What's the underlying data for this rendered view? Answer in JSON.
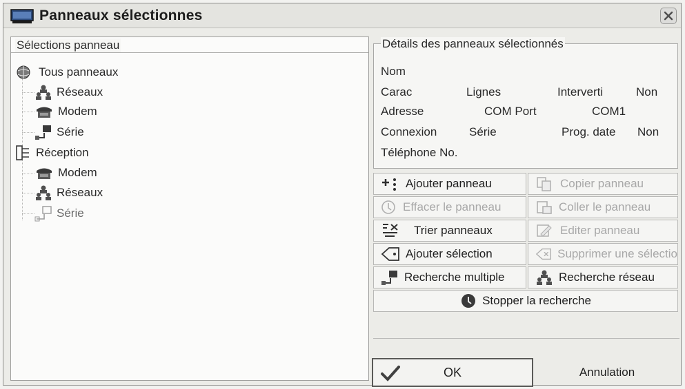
{
  "window": {
    "title": "Panneaux sélectionnes",
    "close_icon": "close-icon"
  },
  "tree": {
    "group_label": "Sélections panneau",
    "root": {
      "label": "Tous panneaux",
      "icon": "globe-icon"
    },
    "root_children": [
      {
        "label": "Réseaux",
        "icon": "network-icon"
      },
      {
        "label": "Modem",
        "icon": "modem-icon"
      },
      {
        "label": "Série",
        "icon": "serial-icon"
      }
    ],
    "reception": {
      "label": "Réception",
      "icon": "tree-icon"
    },
    "reception_children": [
      {
        "label": "Modem",
        "icon": "modem-icon"
      },
      {
        "label": "Réseaux",
        "icon": "network-icon"
      },
      {
        "label": "Série",
        "icon": "serial-icon"
      }
    ]
  },
  "details": {
    "group_label": "Détails des panneaux sélectionnés",
    "nom_label": "Nom",
    "carac_label": "Carac",
    "carac_value": "Lignes",
    "interverti_label": "Interverti",
    "interverti_value": "Non",
    "adresse_label": "Adresse",
    "adresse_value": "COM Port",
    "adresse_port": "COM1",
    "connexion_label": "Connexion",
    "connexion_value": "Série",
    "progdate_label": "Prog. date",
    "progdate_value": "Non",
    "telephone_label": "Téléphone No."
  },
  "actions": {
    "ajouter_panneau": "Ajouter panneau",
    "copier_panneau": "Copier panneau",
    "effacer_panneau": "Effacer le panneau",
    "coller_panneau": "Coller le panneau",
    "trier_panneaux": "Trier panneaux",
    "editer_panneau": "Editer panneau",
    "ajouter_selection": "Ajouter sélection",
    "supprimer_selection": "Supprimer une sélectio",
    "recherche_multiple": "Recherche multiple",
    "recherche_reseau": "Recherche réseau",
    "stopper_recherche": "Stopper la recherche"
  },
  "footer": {
    "ok_label": "OK",
    "cancel_label": "Annulation"
  }
}
